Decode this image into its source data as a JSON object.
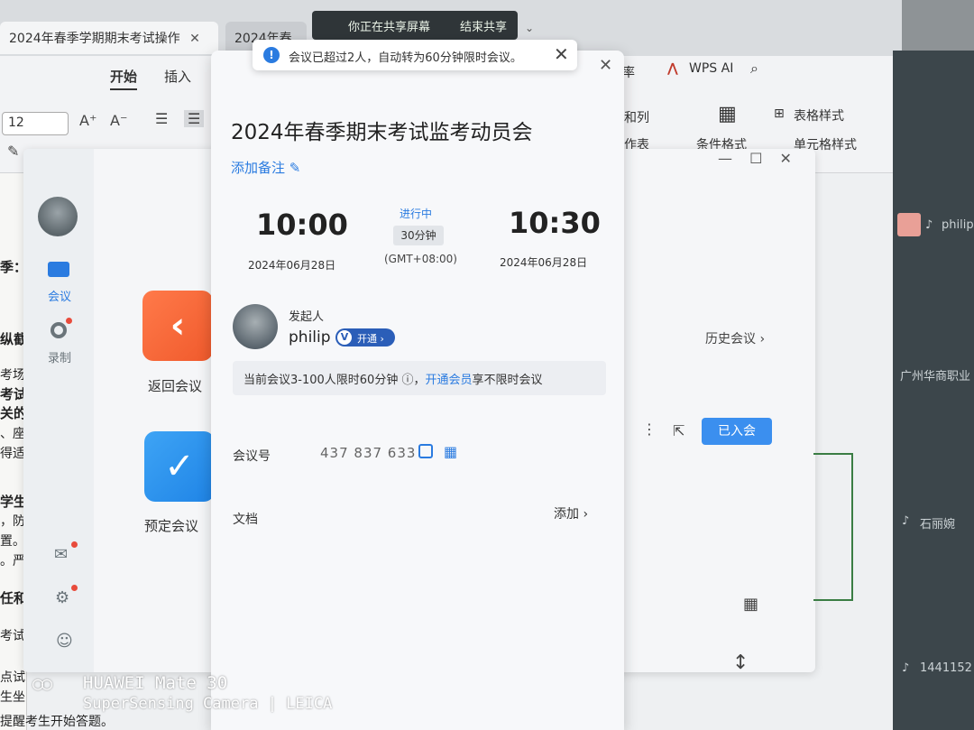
{
  "wps": {
    "tabs": [
      {
        "label": "2024年春季学期期末考试操作",
        "close": "✕"
      },
      {
        "label": "2024年春"
      }
    ],
    "ribbon_tabs": [
      "开始",
      "插入"
    ],
    "font_size": "12",
    "right_items": {
      "rate": "率",
      "wps_ai": "WPS AI",
      "rows_cols": "和列",
      "table_style": "表格样式",
      "cell_style": "单元格样式",
      "cond_format": "条件格式",
      "worksheet": "作表"
    },
    "doc_lines": [
      "季：",
      "纵截",
      "考场",
      "考试",
      "关的",
      "、座",
      "得适",
      "学生",
      "，防",
      "置。",
      "。严",
      "任和",
      "考试",
      "点试",
      "生坐",
      "提醒考生开始答题。"
    ]
  },
  "share_bar": {
    "sharing": "你正在共享屏幕",
    "stop": "结束共享",
    "caret": "⌄"
  },
  "toast": {
    "icon": "!",
    "text": "会议已超过2人，自动转为60分钟限时会议。",
    "close": "✕"
  },
  "meeting_app": {
    "nav": {
      "meeting": "会议",
      "record": "录制"
    },
    "window_controls": "— ☐ ✕",
    "back_meeting": "返回会议",
    "book_meeting": "预定会议",
    "history": "历史会议 ›",
    "joined": "已入会",
    "more": "⋮",
    "share": "⇱",
    "calendar_add": "▦",
    "resize": "↕"
  },
  "card": {
    "close": "✕",
    "title": "2024年春季期末考试监考动员会",
    "add_note": "添加备注 ✎",
    "start_time": "10:00",
    "end_time": "10:30",
    "start_date": "2024年06月28日",
    "end_date": "2024年06月28日",
    "status": "进行中",
    "duration": "30分钟",
    "timezone": "(GMT+08:00)",
    "host_caption": "发起人",
    "host_name": "philip",
    "vip_v": "V",
    "vip_text": "开通 ›",
    "limit_pre": "当前会议3-100人限时60分钟 ⓘ，",
    "limit_link": "开通会员",
    "limit_post": "享不限时会议",
    "meeting_id_label": "会议号",
    "meeting_id": "437 837 633",
    "qr": "▦",
    "doc_label": "文档",
    "doc_add": "添加 ›"
  },
  "video_panel": {
    "names": [
      "philip",
      "广州华商职业",
      "石丽婉",
      "1441152"
    ]
  },
  "watermark": {
    "logo": "○○",
    "line1": "HUAWEI Mate 30",
    "line2": "SuperSensing Camera | LEICA"
  },
  "colors": {
    "accent": "#2a7be0",
    "back_tile": "#f05a2c",
    "book_tile": "#1f84e6",
    "joined_button": "#3b8fef"
  }
}
